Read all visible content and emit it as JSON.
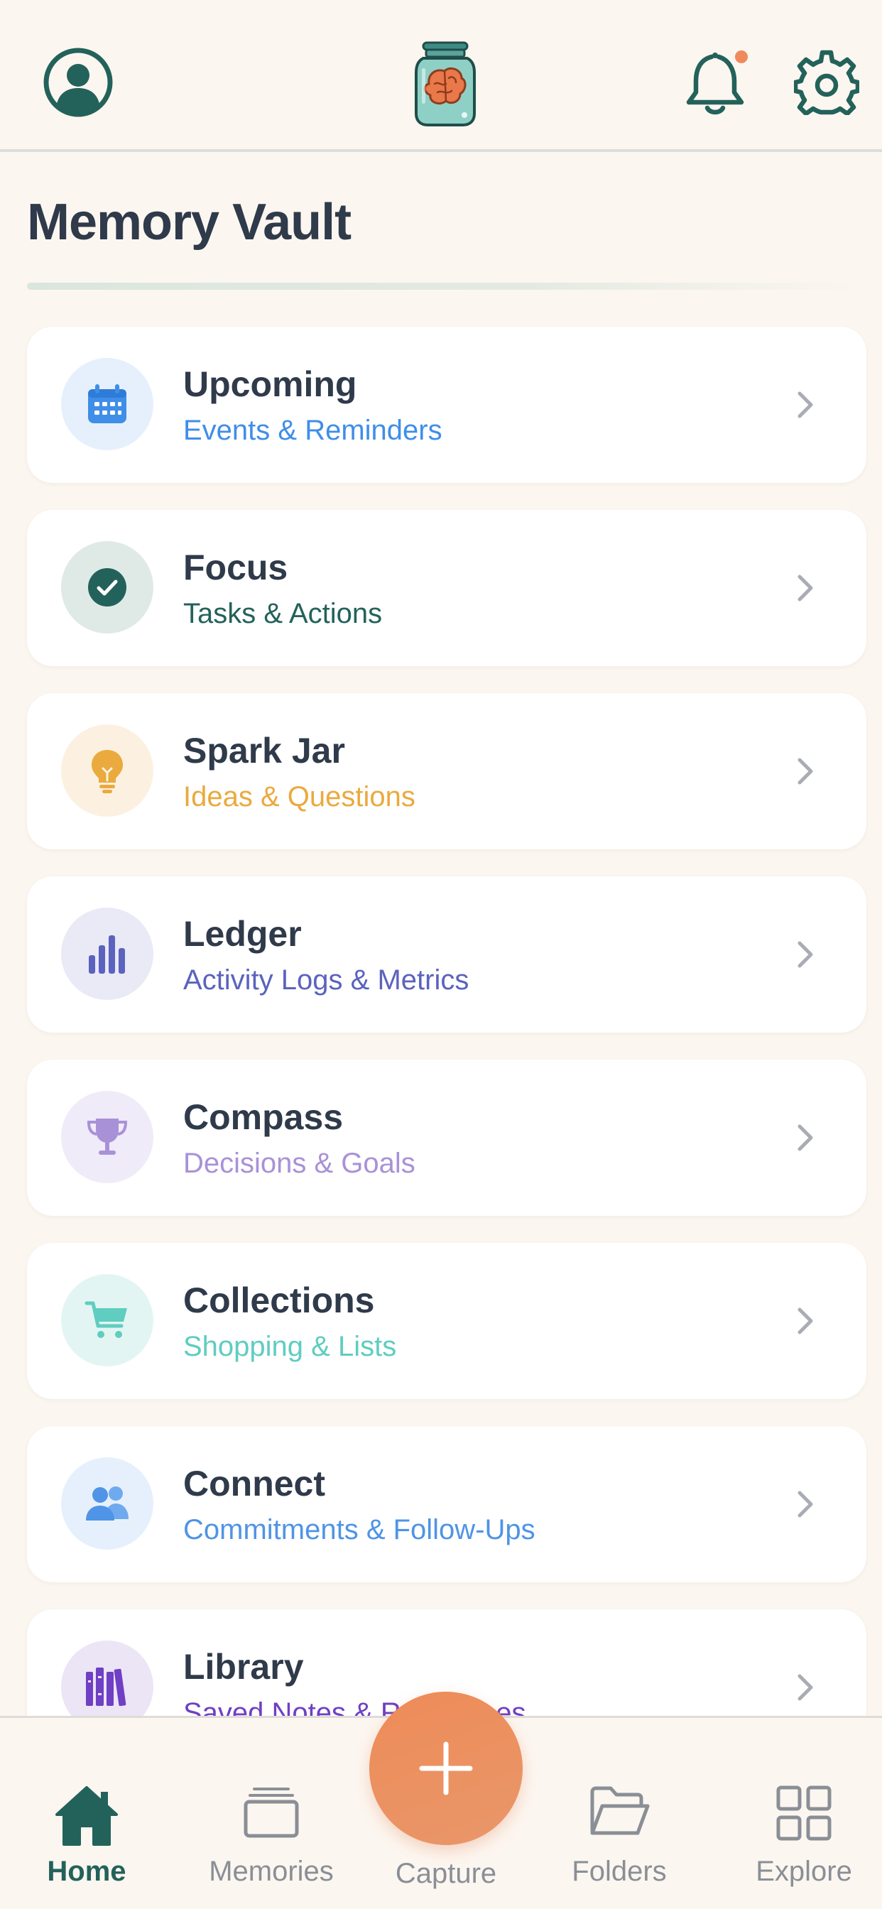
{
  "header": {
    "profile_icon": "person-circle-icon",
    "logo_icon": "brain-jar-logo",
    "notifications_icon": "bell-icon",
    "settings_icon": "gear-icon"
  },
  "page": {
    "title": "Memory Vault"
  },
  "cards": [
    {
      "title": "Upcoming",
      "subtitle": "Events & Reminders",
      "icon": "calendar-icon",
      "accent": "#3F8EE8",
      "icon_bg": "#E6F0FC"
    },
    {
      "title": "Focus",
      "subtitle": "Tasks & Actions",
      "icon": "check-circle-icon",
      "accent": "#23625A",
      "icon_bg": "#DFEAE7"
    },
    {
      "title": "Spark Jar",
      "subtitle": "Ideas & Questions",
      "icon": "lightbulb-icon",
      "accent": "#EAAA3E",
      "icon_bg": "#FCF1E0"
    },
    {
      "title": "Ledger",
      "subtitle": "Activity Logs & Metrics",
      "icon": "bar-chart-icon",
      "accent": "#5B63BE",
      "icon_bg": "#E9EAF6"
    },
    {
      "title": "Compass",
      "subtitle": "Decisions & Goals",
      "icon": "trophy-icon",
      "accent": "#A991D8",
      "icon_bg": "#F0EBF8"
    },
    {
      "title": "Collections",
      "subtitle": "Shopping & Lists",
      "icon": "shopping-cart-icon",
      "accent": "#5FCDC0",
      "icon_bg": "#E3F5F2"
    },
    {
      "title": "Connect",
      "subtitle": "Commitments & Follow-Ups",
      "icon": "people-icon",
      "accent": "#4F94E6",
      "icon_bg": "#E6F0FC"
    },
    {
      "title": "Library",
      "subtitle": "Saved Notes & References",
      "icon": "books-icon",
      "accent": "#6F3FC4",
      "icon_bg": "#ECE5F6"
    }
  ],
  "nav": {
    "home": "Home",
    "memories": "Memories",
    "capture": "Capture",
    "folders": "Folders",
    "explore": "Explore"
  },
  "colors": {
    "background": "#FCF6F0",
    "primary_teal": "#23625A",
    "capture_orange": "#EE8B58",
    "notification_dot": "#F08A5D",
    "title_text": "#2F3A4A",
    "inactive_nav": "#8A8F96"
  }
}
